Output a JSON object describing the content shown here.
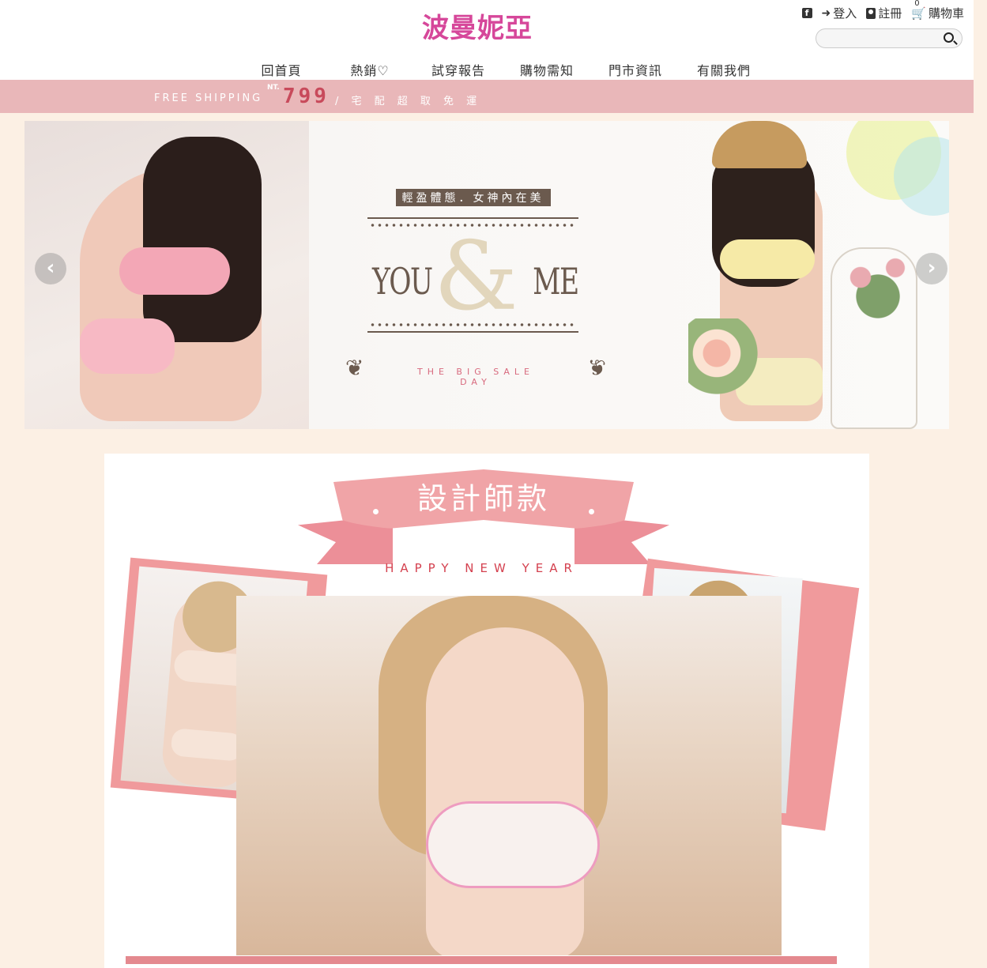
{
  "header": {
    "logo": "波曼妮亞",
    "topbar": {
      "facebook_icon": "facebook-icon",
      "login_label": "登入",
      "register_label": "註冊",
      "cart_label": "購物車",
      "cart_count": "0"
    },
    "search": {
      "placeholder": "",
      "value": ""
    },
    "nav": [
      "回首頁",
      "熱銷♡",
      "試穿報告",
      "購物需知",
      "門市資訊",
      "有關我們"
    ]
  },
  "shipping": {
    "free_text": "FREE SHIPPING",
    "currency": "NT.",
    "price": "799",
    "suffix": "/ 宅 配 超 取 免 運"
  },
  "banner": {
    "tagline": "輕盈體態．女神內在美",
    "word_left": "YOU",
    "amp": "&",
    "word_right": "ME",
    "sale": "THE BIG SALE DAY",
    "prev_label": "‹",
    "next_label": "›"
  },
  "designer": {
    "title": "設計師款",
    "subtitle": "HAPPY NEW YEAR"
  },
  "colors": {
    "brand_pink": "#d6479a",
    "ship_bar": "#e9b7b9",
    "page_bg": "#fcf0e4",
    "ribbon": "#f0a4a7"
  }
}
